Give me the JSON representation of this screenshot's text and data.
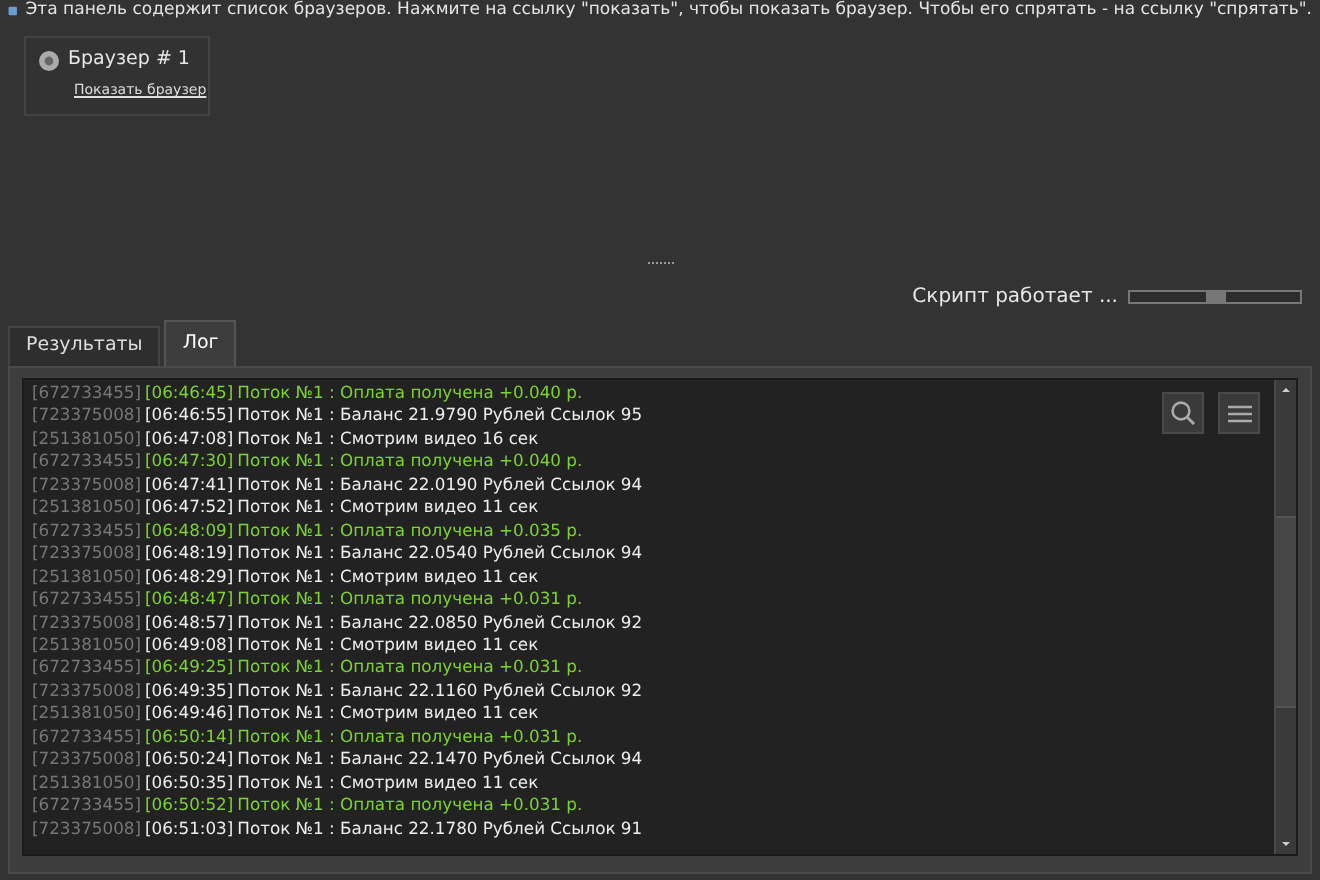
{
  "info_text": "Эта панель содержит список браузеров. Нажмите на ссылку \"показать\", чтобы показать браузер. Чтобы его спрятать - на ссылку \"спрятать\".",
  "browsers": [
    {
      "title": "Браузер # 1",
      "link": "Показать браузер"
    }
  ],
  "status": {
    "text": "Скрипт работает ..."
  },
  "tabs": [
    {
      "label": "Результаты",
      "selected": false
    },
    {
      "label": "Лог",
      "selected": true
    }
  ],
  "log": [
    {
      "kind": "payment",
      "id": "[672733455]",
      "time": "[06:46:45]",
      "message": "Поток №1 : Оплата получена +0.040 р."
    },
    {
      "kind": "info",
      "id": "[723375008]",
      "time": "[06:46:55]",
      "message": "Поток №1 : Баланс 21.9790 Рублей Ссылок 95"
    },
    {
      "kind": "info",
      "id": "[251381050]",
      "time": "[06:47:08]",
      "message": "Поток №1 : Смотрим видео 16 сек"
    },
    {
      "kind": "payment",
      "id": "[672733455]",
      "time": "[06:47:30]",
      "message": "Поток №1 : Оплата получена +0.040 р."
    },
    {
      "kind": "info",
      "id": "[723375008]",
      "time": "[06:47:41]",
      "message": "Поток №1 : Баланс 22.0190 Рублей Ссылок 94"
    },
    {
      "kind": "info",
      "id": "[251381050]",
      "time": "[06:47:52]",
      "message": "Поток №1 : Смотрим видео 11 сек"
    },
    {
      "kind": "payment",
      "id": "[672733455]",
      "time": "[06:48:09]",
      "message": "Поток №1 : Оплата получена +0.035 р."
    },
    {
      "kind": "info",
      "id": "[723375008]",
      "time": "[06:48:19]",
      "message": "Поток №1 : Баланс 22.0540 Рублей Ссылок 94"
    },
    {
      "kind": "info",
      "id": "[251381050]",
      "time": "[06:48:29]",
      "message": "Поток №1 : Смотрим видео 11 сек"
    },
    {
      "kind": "payment",
      "id": "[672733455]",
      "time": "[06:48:47]",
      "message": "Поток №1 : Оплата получена +0.031 р."
    },
    {
      "kind": "info",
      "id": "[723375008]",
      "time": "[06:48:57]",
      "message": "Поток №1 : Баланс 22.0850 Рублей Ссылок 92"
    },
    {
      "kind": "info",
      "id": "[251381050]",
      "time": "[06:49:08]",
      "message": "Поток №1 : Смотрим видео 11 сек"
    },
    {
      "kind": "payment",
      "id": "[672733455]",
      "time": "[06:49:25]",
      "message": "Поток №1 : Оплата получена +0.031 р."
    },
    {
      "kind": "info",
      "id": "[723375008]",
      "time": "[06:49:35]",
      "message": "Поток №1 : Баланс 22.1160 Рублей Ссылок 92"
    },
    {
      "kind": "info",
      "id": "[251381050]",
      "time": "[06:49:46]",
      "message": "Поток №1 : Смотрим видео 11 сек"
    },
    {
      "kind": "payment",
      "id": "[672733455]",
      "time": "[06:50:14]",
      "message": "Поток №1 : Оплата получена +0.031 р."
    },
    {
      "kind": "info",
      "id": "[723375008]",
      "time": "[06:50:24]",
      "message": "Поток №1 : Баланс 22.1470 Рублей Ссылок 94"
    },
    {
      "kind": "info",
      "id": "[251381050]",
      "time": "[06:50:35]",
      "message": "Поток №1 : Смотрим видео 11 сек"
    },
    {
      "kind": "payment",
      "id": "[672733455]",
      "time": "[06:50:52]",
      "message": "Поток №1 : Оплата получена +0.031 р."
    },
    {
      "kind": "info",
      "id": "[723375008]",
      "time": "[06:51:03]",
      "message": "Поток №1 : Баланс 22.1780 Рублей Ссылок 91"
    }
  ]
}
